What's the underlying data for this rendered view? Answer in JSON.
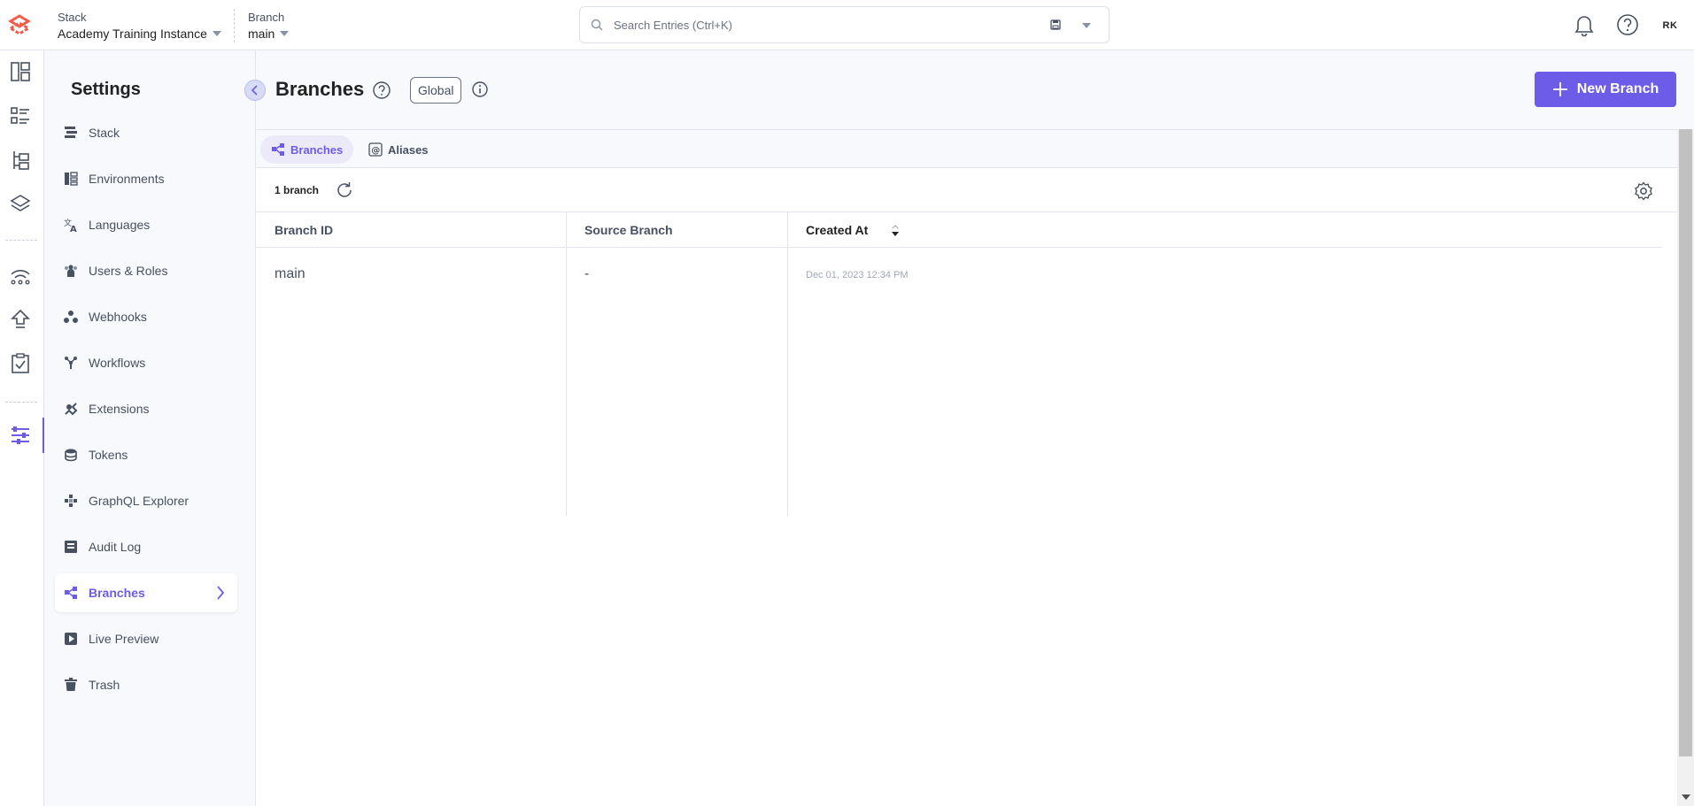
{
  "header": {
    "stack_label": "Stack",
    "stack_value": "Academy Training Instance",
    "branch_label": "Branch",
    "branch_value": "main",
    "search_placeholder": "Search Entries (Ctrl+K)",
    "avatar_initials": "RK"
  },
  "rail": {
    "icons": [
      "dashboard-icon",
      "entries-icon",
      "content-models-icon",
      "assets-icon",
      "publish-queue-icon",
      "deploy-icon",
      "tasks-icon",
      "settings-icon"
    ],
    "active": "settings-icon"
  },
  "settings": {
    "title": "Settings",
    "items": [
      {
        "label": "Stack",
        "icon": "stack-icon"
      },
      {
        "label": "Environments",
        "icon": "environments-icon"
      },
      {
        "label": "Languages",
        "icon": "languages-icon"
      },
      {
        "label": "Users & Roles",
        "icon": "users-icon"
      },
      {
        "label": "Webhooks",
        "icon": "webhooks-icon"
      },
      {
        "label": "Workflows",
        "icon": "workflows-icon"
      },
      {
        "label": "Extensions",
        "icon": "extensions-icon"
      },
      {
        "label": "Tokens",
        "icon": "tokens-icon"
      },
      {
        "label": "GraphQL Explorer",
        "icon": "graphql-icon"
      },
      {
        "label": "Audit Log",
        "icon": "audit-log-icon"
      },
      {
        "label": "Branches",
        "icon": "branches-icon"
      },
      {
        "label": "Live Preview",
        "icon": "live-preview-icon"
      },
      {
        "label": "Trash",
        "icon": "trash-icon"
      }
    ],
    "active": "Branches"
  },
  "page": {
    "title": "Branches",
    "badge": "Global",
    "new_button": "New Branch"
  },
  "tabs": [
    {
      "label": "Branches",
      "active": true
    },
    {
      "label": "Aliases",
      "active": false
    }
  ],
  "table": {
    "count": "1 branch",
    "columns": [
      "Branch ID",
      "Source Branch",
      "Created At"
    ],
    "sorted_column": "Created At",
    "rows": [
      {
        "branch_id": "main",
        "source": "-",
        "created": "Dec 01, 2023 12:34 PM"
      }
    ]
  },
  "colors": {
    "accent": "#6c5ce7",
    "logo": "#f05d4a"
  }
}
